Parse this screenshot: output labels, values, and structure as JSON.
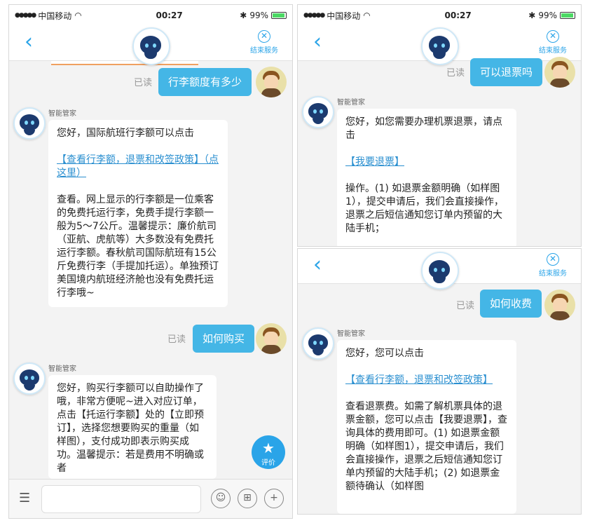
{
  "status": {
    "carrier": "中国移动",
    "time": "00:27",
    "battery": "99%"
  },
  "nav": {
    "end_label": "结束服务"
  },
  "sender": "智能管家",
  "read_label": "已读",
  "left": {
    "q1": "行李额度有多少",
    "a1_line1": "您好，国际航班行李额可以点击",
    "a1_link": "【查看行李额，退票和改签政策】（点这里）",
    "a1_body": "查看。网上显示的行李额是一位乘客的免费托运行李，免费手提行李额一般为5～7公斤。温馨提示：廉价航司（亚航、虎航等）大多数没有免费托运行李额。春秋航司国际航班有15公斤免费行李（手提加托运）。单独预订美国境内航班经济舱也没有免费托运行李哦~",
    "q2": "如何购买",
    "a2_body": "您好，购买行李额可以自助操作了哦，非常方便呢~进入对应订单，点击【托运行李额】处的【立即预订】，选择您想要购买的重量（如样图），支付成功即表示购买成功。温馨提示：若是费用不明确或者",
    "rate_label": "评价"
  },
  "right_top": {
    "q": "可以退票吗",
    "a_line1": "您好，如您需要办理机票退票，请点击",
    "a_link": "【我要退票】",
    "a_body": "操作。(1) 如退票金额明确（如样图1），提交申请后，我们会直接操作，退票之后短信通知您订单内预留的大陆手机；"
  },
  "right_bottom": {
    "q": "如何收费",
    "a_line1": "您好，您可以点击",
    "a_link": "【查看行李额，退票和改签政策】",
    "a_body": "查看退票费。如需了解机票具体的退票金额，您可以点击【我要退票】，查询具体的费用即可。(1) 如退票金额明确（如样图1），提交申请后，我们会直接操作，退票之后短信通知您订单内预留的大陆手机；(2) 如退票金额待确认（如样图"
  },
  "icons": {
    "back": "chevron-left-icon",
    "close": "close-circle-icon",
    "menu": "list-icon",
    "emoji": "smile-icon",
    "gift": "gift-icon",
    "add": "plus-icon",
    "star": "star-icon"
  },
  "accent": "#2aa4e8",
  "bubble_color": "#44b6e6"
}
